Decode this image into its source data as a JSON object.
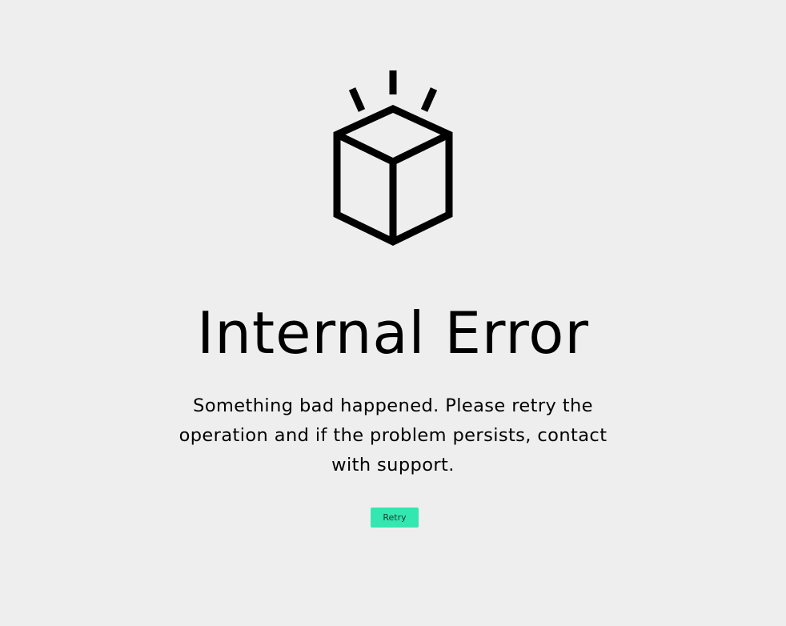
{
  "error": {
    "icon": "box-icon",
    "title": "Internal Error",
    "message": "Something bad happened. Please retry the operation and if the problem persists, contact with support."
  },
  "actions": {
    "retry_label": "Retry"
  },
  "colors": {
    "background": "#eeeeee",
    "text": "#000000",
    "retry_button": "#33e8b0"
  }
}
